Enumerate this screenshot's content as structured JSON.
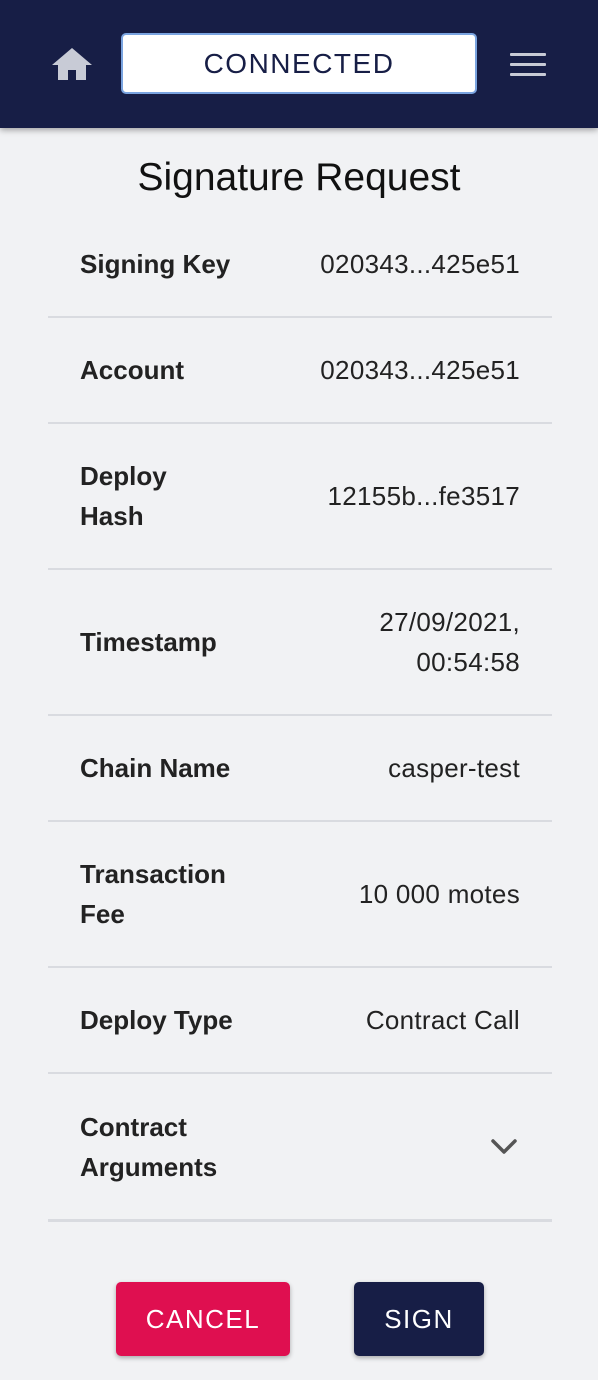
{
  "header": {
    "status": "CONNECTED",
    "background": "#171e46"
  },
  "page": {
    "title": "Signature Request"
  },
  "details": [
    {
      "label": "Signing Key",
      "value": "020343...425e51"
    },
    {
      "label": "Account",
      "value": "020343...425e51"
    },
    {
      "label": "Deploy Hash",
      "value": "12155b...fe3517"
    },
    {
      "label": "Timestamp",
      "value": "27/09/2021, 00:54:58"
    },
    {
      "label": "Chain Name",
      "value": "casper-test"
    },
    {
      "label": "Transaction Fee",
      "value": "10 000 motes"
    },
    {
      "label": "Deploy Type",
      "value": "Contract Call"
    },
    {
      "label": "Contract Arguments",
      "value": ""
    }
  ],
  "actions": {
    "cancel_label": "CANCEL",
    "sign_label": "SIGN",
    "cancel_color": "#df0f50",
    "sign_color": "#171e46"
  }
}
